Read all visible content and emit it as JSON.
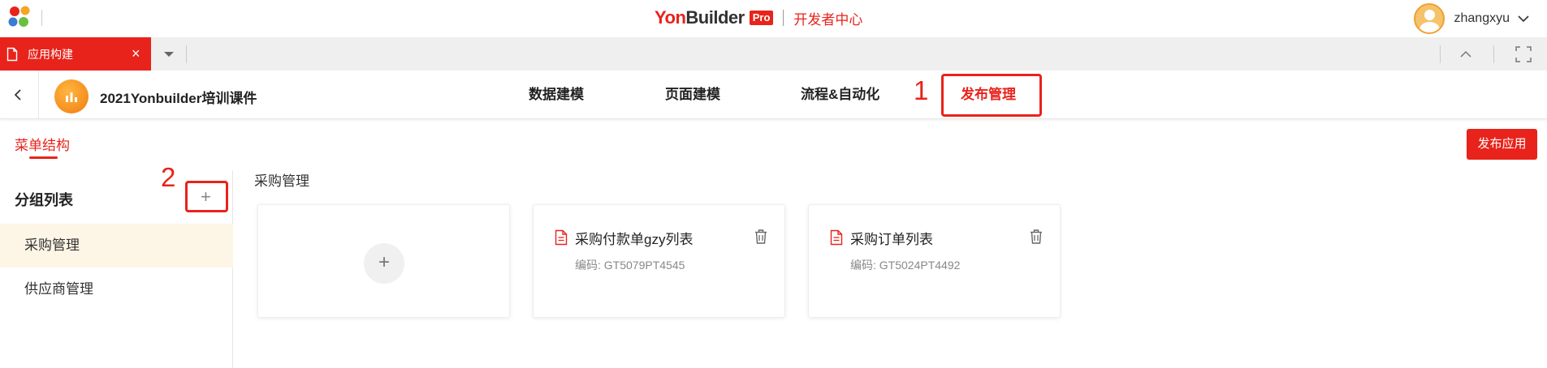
{
  "topbar": {
    "brand_yon": "Yon",
    "brand_builder": "Builder",
    "brand_pro": "Pro",
    "brand_sub": "开发者中心",
    "user_name": "zhangxyu"
  },
  "tabs": {
    "active_label": "应用构建",
    "close_glyph": "×"
  },
  "app": {
    "name": "2021Yonbuilder培训课件",
    "nav": [
      "数据建模",
      "页面建模",
      "流程&自动化",
      "发布管理"
    ],
    "active_nav": "发布管理"
  },
  "annotations": {
    "one": "1",
    "two": "2"
  },
  "sub": {
    "menu_structure": "菜单结构",
    "publish_button": "发布应用"
  },
  "left": {
    "group_title": "分组列表",
    "add_glyph": "+",
    "groups": [
      "采购管理",
      "供应商管理"
    ]
  },
  "main": {
    "section_title": "采购管理",
    "add_glyph": "+",
    "cards": [
      {
        "title": "采购付款单gzy列表",
        "code": "编码: GT5079PT4545"
      },
      {
        "title": "采购订单列表",
        "code": "编码: GT5024PT4492"
      }
    ]
  },
  "colors": {
    "accent": "#e8231b",
    "selected_bg": "#fdf5e6"
  }
}
